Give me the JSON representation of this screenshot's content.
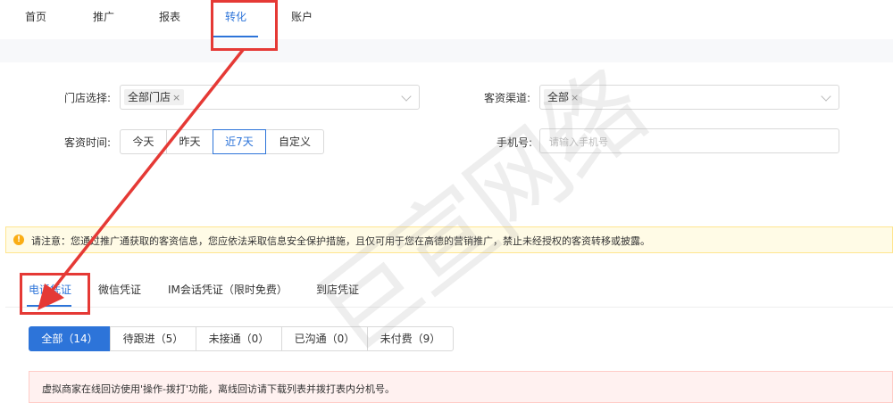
{
  "nav": {
    "items": [
      "首页",
      "推广",
      "报表",
      "转化",
      "账户"
    ],
    "active_index": 3
  },
  "filters": {
    "store_label": "门店选择:",
    "store_tag": "全部门店",
    "channel_label": "客资渠道:",
    "channel_tag": "全部",
    "time_label": "客资时间:",
    "time_options": [
      "今天",
      "昨天",
      "近7天",
      "自定义"
    ],
    "time_active": "近7天",
    "phone_label": "手机号:",
    "phone_placeholder": "请输入手机号"
  },
  "notice": {
    "text": "请注意：您通过推广通获取的客资信息，您应依法采取信息安全保护措施，且仅可用于您在高德的营销推广，禁止未经授权的客资转移或披露。"
  },
  "tabs": [
    "电话凭证",
    "微信凭证",
    "IM会话凭证（限时免费）",
    "到店凭证"
  ],
  "active_tab": "电话凭证",
  "status_filters": [
    "全部（14）",
    "待跟进（5）",
    "未接通（0）",
    "已沟通（0）",
    "未付费（9）"
  ],
  "active_status": "全部（14）",
  "alert": {
    "text": "虚拟商家在线回访使用'操作-拨打'功能，离线回访请下载列表并拨打表内分机号。"
  },
  "watermark": "巨宣网络",
  "colors": {
    "accent": "#2d74d9",
    "annotation": "#e53935",
    "notice_bg": "#fffbe6",
    "alert_bg": "#fff1f0"
  }
}
